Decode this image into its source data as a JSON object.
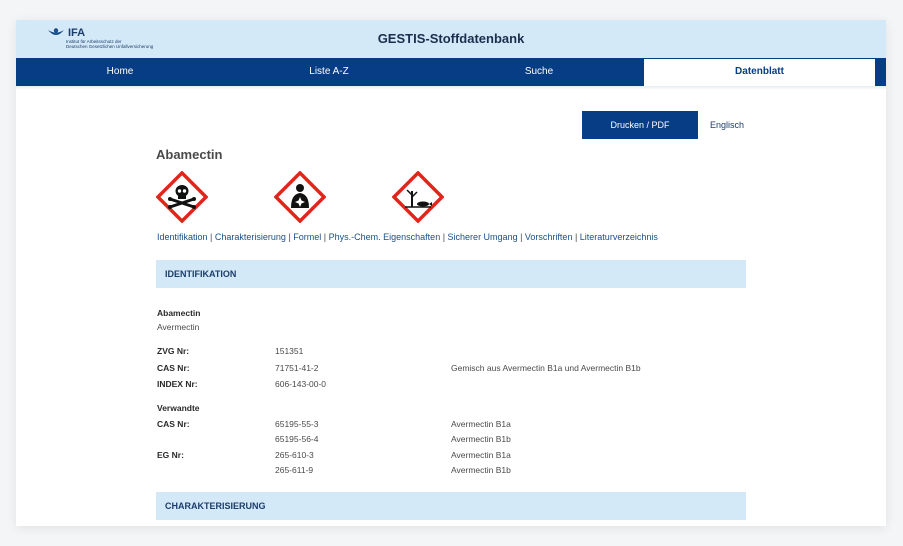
{
  "header": {
    "logo_name": "IFA",
    "logo_subline_1": "Institut für Arbeitsschutz der",
    "logo_subline_2": "Deutschen Gesetzlichen Unfallversicherung",
    "app_title": "GESTIS-Stoffdatenbank"
  },
  "nav": {
    "home": "Home",
    "list": "Liste A-Z",
    "search": "Suche",
    "datasheet": "Datenblatt"
  },
  "actions": {
    "print": "Drucken / PDF",
    "language": "Englisch"
  },
  "substance": {
    "title": "Abamectin"
  },
  "pictograms": [
    "skull-crossbones-icon",
    "health-hazard-icon",
    "environment-icon"
  ],
  "section_links": [
    "Identifikation",
    "Charakterisierung",
    "Formel",
    "Phys.-Chem. Eigenschaften",
    "Sicherer Umgang",
    "Vorschriften",
    "Literaturverzeichnis"
  ],
  "identifikation": {
    "heading": "IDENTIFIKATION",
    "name": "Abamectin",
    "synonym": "Avermectin",
    "zvg_label": "ZVG Nr:",
    "zvg_value": "151351",
    "cas_label": "CAS Nr:",
    "cas_value": "71751-41-2",
    "cas_note": "Gemisch aus Avermectin B1a und Avermectin B1b",
    "index_label": "INDEX Nr:",
    "index_value": "606-143-00-0",
    "related_heading": "Verwandte",
    "related_cas_label": "CAS Nr:",
    "related_cas": [
      {
        "number": "65195-55-3",
        "name": "Avermectin B1a"
      },
      {
        "number": "65195-56-4",
        "name": "Avermectin B1b"
      }
    ],
    "related_eg_label": "EG Nr:",
    "related_eg": [
      {
        "number": "265-610-3",
        "name": "Avermectin B1a"
      },
      {
        "number": "265-611-9",
        "name": "Avermectin B1b"
      }
    ]
  },
  "charakterisierung": {
    "heading": "CHARAKTERISIERUNG"
  },
  "colors": {
    "nav_blue": "#063d84",
    "header_light_blue": "#d4e9f8",
    "hazard_red": "#e1251b"
  }
}
